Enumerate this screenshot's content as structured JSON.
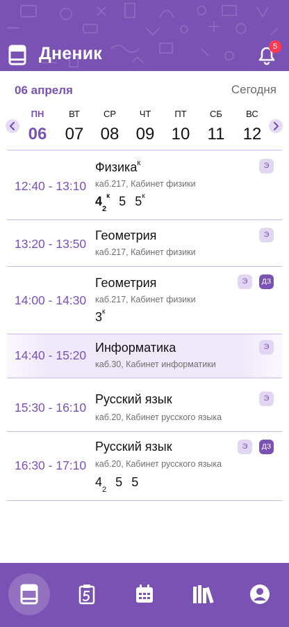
{
  "header": {
    "title": "Дненик",
    "notifications_count": "5"
  },
  "date_bar": {
    "current_date": "06 апреля",
    "today_label": "Сегодня"
  },
  "week": {
    "days": [
      {
        "name": "ПН",
        "date": "06",
        "active": true
      },
      {
        "name": "ВТ",
        "date": "07"
      },
      {
        "name": "СР",
        "date": "08"
      },
      {
        "name": "ЧТ",
        "date": "09"
      },
      {
        "name": "ПТ",
        "date": "10"
      },
      {
        "name": "СБ",
        "date": "11"
      },
      {
        "name": "ВС",
        "date": "12"
      }
    ]
  },
  "lessons": [
    {
      "time": "12:40 - 13:10",
      "subject": "Физика",
      "subject_mark": "к",
      "room": "каб.217, Кабинет физики",
      "grades": [
        {
          "value": "4",
          "sub": "2",
          "sup": "к",
          "bold": true
        },
        {
          "value": "5"
        },
        {
          "value": "5",
          "sup": "к"
        }
      ],
      "tags": [
        "Э"
      ]
    },
    {
      "time": "13:20 - 13:50",
      "subject": "Геометрия",
      "room": "каб.217, Кабинет физики",
      "tags": [
        "Э"
      ]
    },
    {
      "time": "14:00 - 14:30",
      "subject": "Геометрия",
      "room": "каб.217, Кабинет физики",
      "grades": [
        {
          "value": "3",
          "sup": "к"
        }
      ],
      "tags": [
        "Э",
        "ДЗ"
      ]
    },
    {
      "time": "14:40 - 15:20",
      "subject": "Информатика",
      "room": "каб.30, Кабинет информатики",
      "current": true,
      "tags": [
        "Э"
      ]
    },
    {
      "time": "15:30 - 16:10",
      "subject": "Русский язык",
      "room": "каб.20, Кабинет русского языка",
      "tags": [
        "Э"
      ]
    },
    {
      "time": "16:30 - 17:10",
      "subject": "Русский язык",
      "room": "каб.20, Кабинет русского языка",
      "grades": [
        {
          "value": "4",
          "sub": "2"
        },
        {
          "value": "5"
        },
        {
          "value": "5"
        }
      ],
      "tags": [
        "Э",
        "ДЗ"
      ]
    }
  ],
  "bottom_nav": {
    "items": [
      "diary-icon",
      "grades-icon",
      "calendar-icon",
      "library-icon",
      "profile-icon"
    ],
    "active": "diary-icon"
  },
  "colors": {
    "accent": "#7a52b3",
    "accent_light": "#e2d7f3",
    "badge": "#ff3b52"
  }
}
